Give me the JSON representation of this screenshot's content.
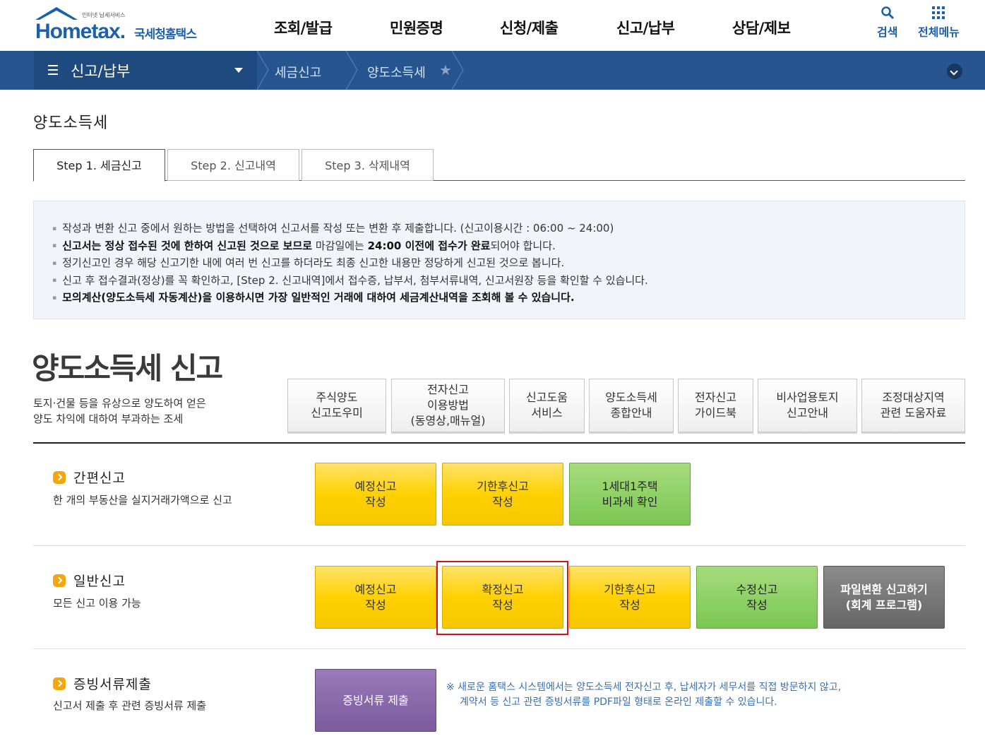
{
  "header": {
    "logo_small": "인터넷 납세서비스",
    "logo_main": "Hometax.",
    "logo_kor": "국세청홈택스",
    "nav": [
      "조회/발급",
      "민원증명",
      "신청/제출",
      "신고/납부",
      "상담/제보"
    ],
    "search_label": "검색",
    "allmenu_label": "전체메뉴"
  },
  "navbar": {
    "menu_label": "신고/납부",
    "crumb1": "세금신고",
    "crumb2": "양도소득세"
  },
  "page_title": "양도소득세",
  "tabs": [
    "Step 1. 세금신고",
    "Step 2. 신고내역",
    "Step 3. 삭제내역"
  ],
  "info": {
    "line1": "작성과 변환 신고 중에서 원하는 방법을 선택하여 신고서를 작성 또는 변환 후 제출합니다. (신고이용시간 : 06:00 ~ 24:00)",
    "line2_bold1": "신고서는 정상 접수된 것에 한하여 신고된 것으로 보므로",
    "line2_mid": " 마감일에는 ",
    "line2_bold2": "24:00 이전에 접수가 완료",
    "line2_end": "되어야 합니다.",
    "line3": "정기신고인 경우 해당 신고기한 내에 여러 번 신고를 하더라도 최종 신고한 내용만 정당하게 신고된 것으로 봅니다.",
    "line4": "신고 후 접수결과(정상)를 꼭 확인하고, [Step 2. 신고내역]에서 접수증, 납부서, 첨부서류내역, 신고서원장 등을 확인할 수 있습니다.",
    "line5": "모의계산(양도소득세 자동계산)을 이용하시면 가장 일반적인 거래에 대하여 세금계산내역을 조회해 볼 수 있습니다."
  },
  "section": {
    "title": "양도소득세 신고",
    "desc1": "토지·건물 등을 유상으로 양도하여 얻은",
    "desc2": "양도 차익에 대하여 부과하는 조세"
  },
  "tools": [
    {
      "l1": "주식양도",
      "l2": "신고도우미",
      "l3": ""
    },
    {
      "l1": "전자신고",
      "l2": "이용방법",
      "l3": "(동영상,매뉴얼)"
    },
    {
      "l1": "신고도움",
      "l2": "서비스",
      "l3": ""
    },
    {
      "l1": "양도소득세",
      "l2": "종합안내",
      "l3": ""
    },
    {
      "l1": "전자신고",
      "l2": "가이드북",
      "l3": ""
    },
    {
      "l1": "비사업용토지",
      "l2": "신고안내",
      "l3": ""
    },
    {
      "l1": "조정대상지역",
      "l2": "관련 도움자료",
      "l3": ""
    }
  ],
  "simple": {
    "title": "간편신고",
    "sub": "한 개의 부동산을 실지거래가액으로 신고",
    "buttons": [
      {
        "l1": "예정신고",
        "l2": "작성"
      },
      {
        "l1": "기한후신고",
        "l2": "작성"
      },
      {
        "l1": "1세대1주택",
        "l2": "비과세 확인"
      }
    ]
  },
  "general": {
    "title": "일반신고",
    "sub": "모든 신고 이용 가능",
    "buttons": [
      {
        "l1": "예정신고",
        "l2": "작성"
      },
      {
        "l1": "확정신고",
        "l2": "작성"
      },
      {
        "l1": "기한후신고",
        "l2": "작성"
      },
      {
        "l1": "수정신고",
        "l2": "작성"
      },
      {
        "l1": "파일변환 신고하기",
        "l2": "(회계 프로그램)"
      }
    ]
  },
  "evidence": {
    "title": "증빙서류제출",
    "sub": "신고서 제출 후 관련 증빙서류 제출",
    "button": "증빙서류 제출",
    "note1": "※ 새로운 홈택스 시스템에서는 양도소득세 전자신고 후, 납세자가 세무서를 직접 방문하지 않고,",
    "note2": "계약서 등 신고 관련 증빙서류를 PDF파일 형태로 온라인 제출할 수 있습니다."
  },
  "colors": {
    "brand_blue": "#1b5fae",
    "navbar": "#275590",
    "yellow_button": "#ffd100",
    "green_button": "#7ac652",
    "purple_button": "#7b5a9e",
    "highlight_red": "#d0161c"
  }
}
